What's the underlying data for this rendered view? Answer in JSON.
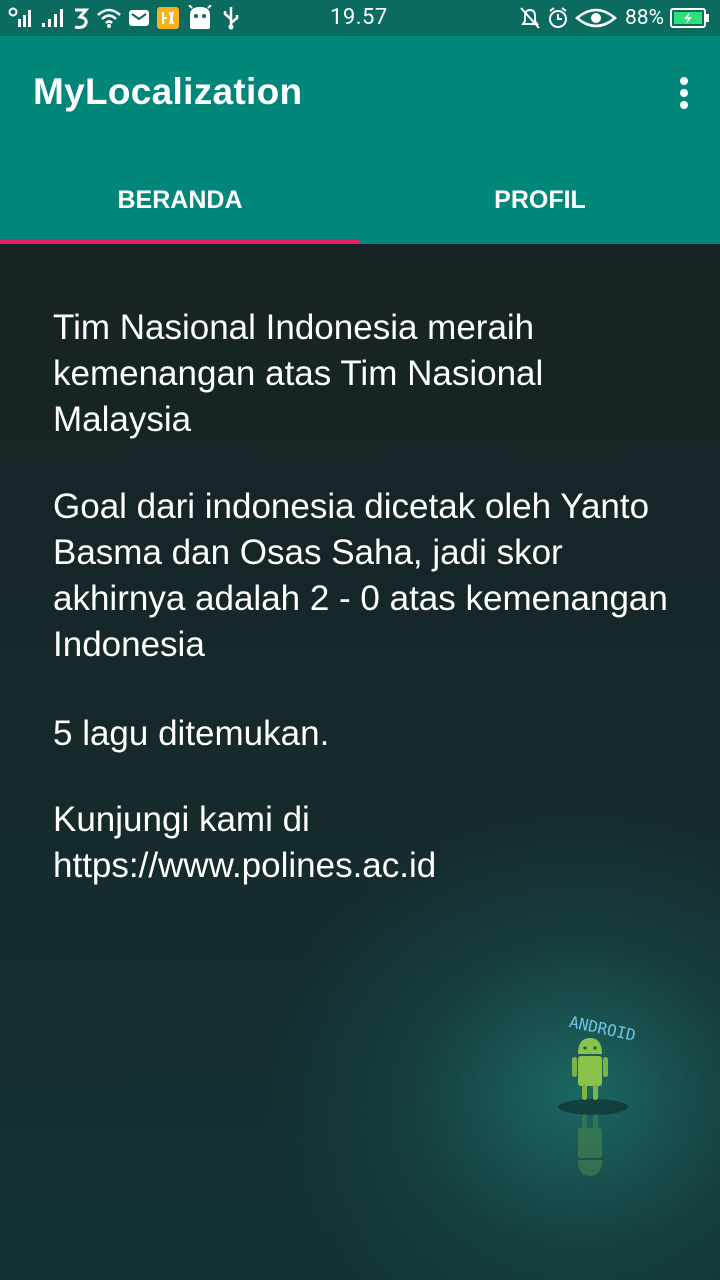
{
  "status_bar": {
    "time": "19.57",
    "battery_percent": "88%",
    "icons": [
      "signal-icon",
      "signal-icon",
      "network-3-icon",
      "wifi-icon",
      "mail-icon",
      "app-icon",
      "android-icon",
      "usb-icon",
      "mute-icon",
      "alarm-icon",
      "eye-icon",
      "battery-charging-icon"
    ]
  },
  "appbar": {
    "title": "MyLocalization",
    "color": "#00877a",
    "overflow_icon": "more-vert-icon"
  },
  "tabs": [
    {
      "label": "BERANDA",
      "active": true
    },
    {
      "label": "PROFIL",
      "active": false
    }
  ],
  "indicator_color": "#e91e63",
  "content": {
    "paragraphs": [
      "Tim Nasional Indonesia meraih kemenangan atas Tim Nasional Malaysia",
      "Goal dari indonesia dicetak oleh Yanto Basma dan Osas Saha, jadi skor akhirnya adalah 2 - 0 atas kemenangan Indonesia",
      "5 lagu ditemukan.",
      "Kunjungi kami di https://www.polines.ac.id"
    ],
    "background_art": "android-robot-icon"
  }
}
